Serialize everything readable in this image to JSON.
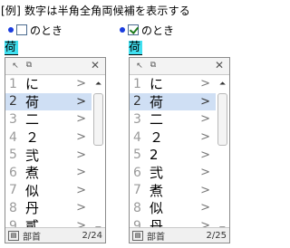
{
  "heading": "[例] 数字は半角全角両候補を表示する",
  "panels": [
    {
      "checked": false,
      "option_label": "のとき",
      "composition": "荷",
      "toolbar": {
        "b1": "↖",
        "b2": "⧉",
        "close": "✕"
      },
      "rows": [
        {
          "num": "1",
          "cand": "に",
          "arrow": ">"
        },
        {
          "num": "2",
          "cand": "荷",
          "arrow": ">"
        },
        {
          "num": "3",
          "cand": "二",
          "arrow": ">"
        },
        {
          "num": "4",
          "cand": "２",
          "arrow": ">"
        },
        {
          "num": "5",
          "cand": "弐",
          "arrow": ">"
        },
        {
          "num": "6",
          "cand": "煮",
          "arrow": ">"
        },
        {
          "num": "7",
          "cand": "似",
          "arrow": ">"
        },
        {
          "num": "8",
          "cand": "丹",
          "arrow": ">"
        },
        {
          "num": "9",
          "cand": "貳",
          "arrow": ">"
        }
      ],
      "selected_index": 1,
      "status": {
        "icon": "▤",
        "bushu": "部首",
        "count": "2/24"
      },
      "scroll": {
        "up": "⏶",
        "down": "⏷"
      }
    },
    {
      "checked": true,
      "option_label": "のとき",
      "composition": "荷",
      "toolbar": {
        "b1": "↖",
        "b2": "⧉",
        "close": "✕"
      },
      "rows": [
        {
          "num": "1",
          "cand": "に",
          "arrow": ">"
        },
        {
          "num": "2",
          "cand": "荷",
          "arrow": ">"
        },
        {
          "num": "3",
          "cand": "二",
          "arrow": ">"
        },
        {
          "num": "4",
          "cand": "２",
          "arrow": ">"
        },
        {
          "num": "5",
          "cand": "2",
          "arrow": ">"
        },
        {
          "num": "6",
          "cand": "弐",
          "arrow": ">"
        },
        {
          "num": "7",
          "cand": "煮",
          "arrow": ">"
        },
        {
          "num": "8",
          "cand": "似",
          "arrow": ">"
        },
        {
          "num": "9",
          "cand": "丹",
          "arrow": ">"
        }
      ],
      "selected_index": 1,
      "status": {
        "icon": "▤",
        "bushu": "部首",
        "count": "2/25"
      },
      "scroll": {
        "up": "⏶",
        "down": "⏷"
      }
    }
  ]
}
